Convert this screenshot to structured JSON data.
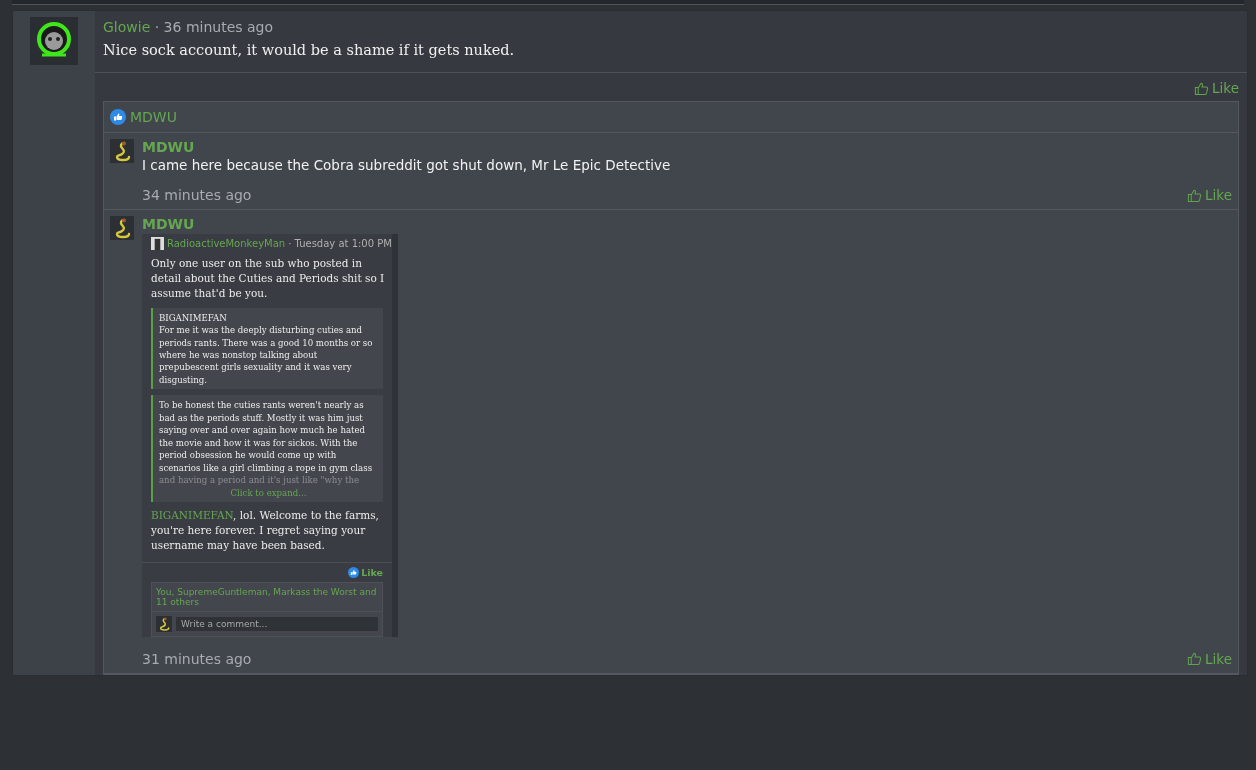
{
  "post": {
    "author": "Glowie",
    "separator": "·",
    "time": "36 minutes ago",
    "body": "Nice sock account, it would be a shame if it gets nuked.",
    "like_label": "Like"
  },
  "comment_area": {
    "reactions": {
      "users": "MDWU"
    },
    "comments": [
      {
        "kind": "text",
        "author": "MDWU",
        "body": "I came here because the Cobra subreddit got shut down, Mr Le Epic Detective",
        "time": "34 minutes ago",
        "like_label": "Like"
      },
      {
        "kind": "image",
        "author": "MDWU",
        "time": "31 minutes ago",
        "like_label": "Like",
        "screenshot": {
          "author": "RadioactiveMonkeyMan",
          "meta": "· Tuesday at 1:00 PM",
          "body": "Only one user on the sub who posted in detail about the Cuties and Periods shit so I assume that'd be you.",
          "quotes": [
            {
              "author": "BIGANIMEFAN",
              "text": "For me it was the deeply disturbing cuties and periods rants. There was a good 10 months or so where he was nonstop talking about prepubescent girls sexuality and it was very disgusting."
            },
            {
              "text": "To be honest the cuties rants weren't nearly as bad as the periods stuff. Mostly it was him just saying over and over again how much he hated the movie and how it was for sickos. With the period obsession he would come up with scenarios like a girl climbing a rope in gym class",
              "faded_text": "and having a period and it's just like \"why the",
              "expand_label": "Click to expand..."
            }
          ],
          "reply_mention": "BIGANIMEFAN",
          "reply_text": ", lol. Welcome to the farms, you're here forever. I regret saying your username may have been based.",
          "like_label": "Like",
          "reactions": "You, SupremeGuntleman, Markass the Worst and 11 others",
          "comment_placeholder": "Write a comment..."
        }
      }
    ]
  }
}
